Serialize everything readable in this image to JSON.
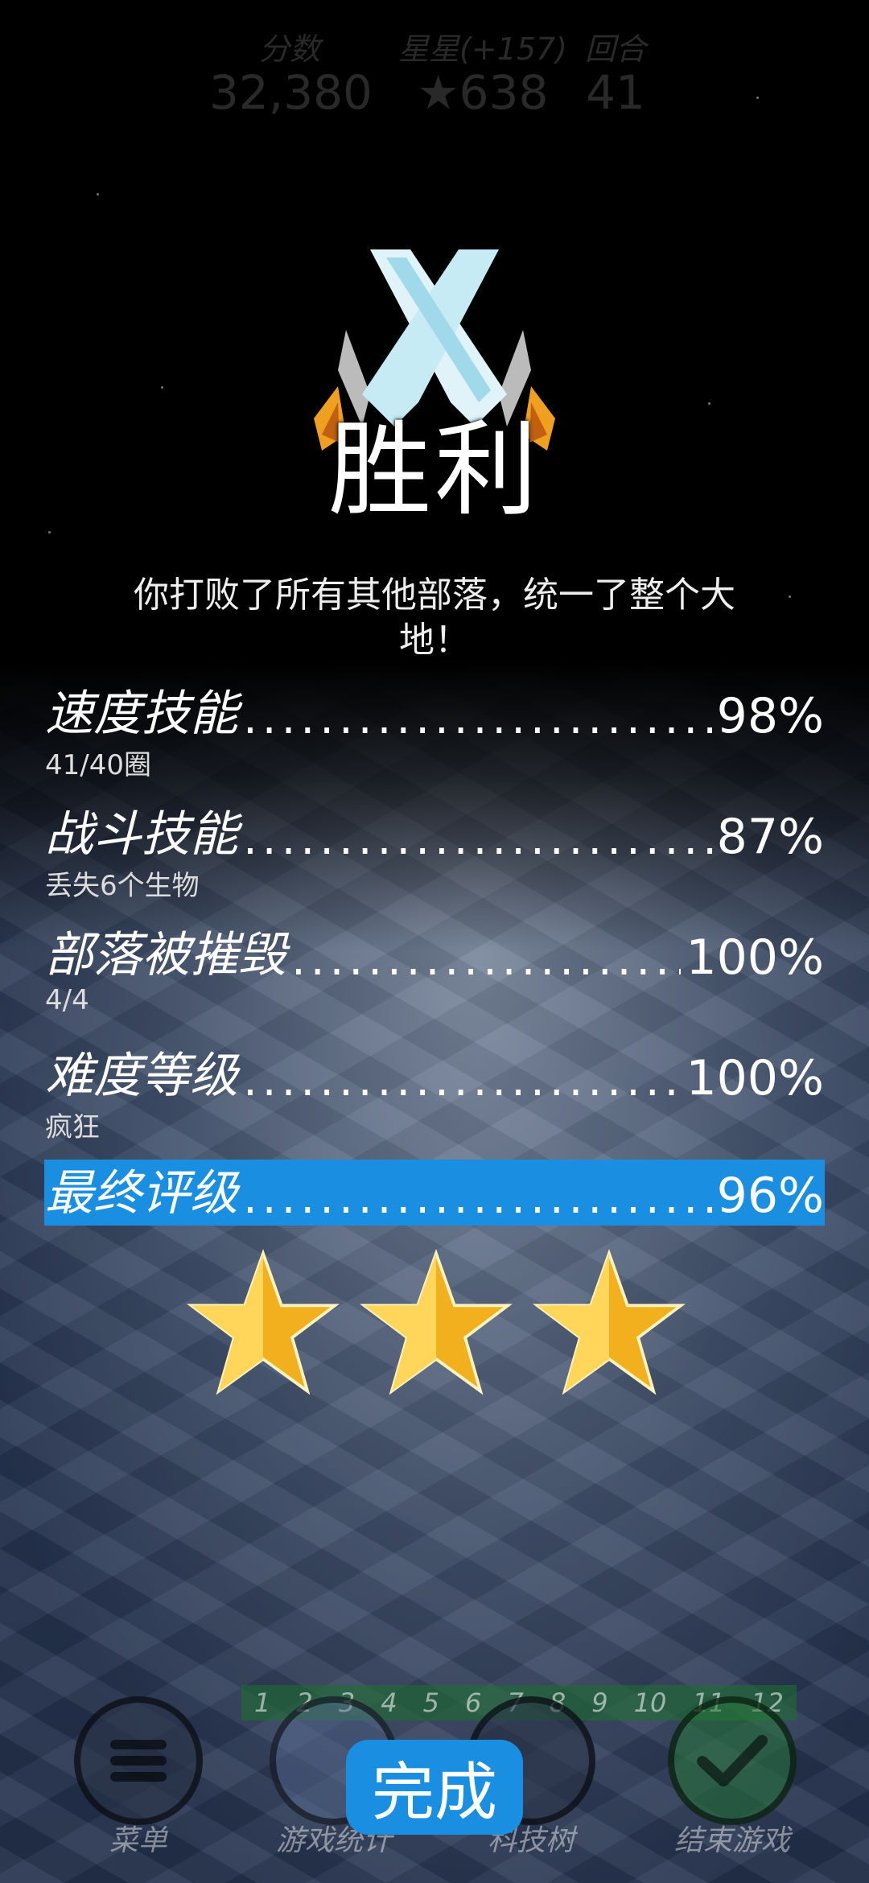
{
  "header": {
    "score_label": "分数",
    "score_value": "32,380",
    "stars_label": "星星(+157)",
    "stars_value": "638",
    "turn_label": "回合",
    "turn_value": "41"
  },
  "result": {
    "title": "胜利",
    "subtitle": "你打败了所有其他部落，统一了整个大地！"
  },
  "ratings": [
    {
      "label": "速度技能",
      "dots": "..........................",
      "percent": "98%",
      "detail": "41/40圈"
    },
    {
      "label": "战斗技能",
      "dots": "..........................",
      "percent": "87%",
      "detail": "丢失6个生物"
    },
    {
      "label": "部落被摧毁",
      "dots": "..........................",
      "percent": "100%",
      "detail": "4/4"
    },
    {
      "label": "难度等级",
      "dots": "..........................",
      "percent": "100%",
      "detail": "疯狂"
    }
  ],
  "final": {
    "label": "最终评级",
    "dots": "..........................",
    "percent": "96%"
  },
  "star_rating": 3,
  "turn_strip": [
    "1",
    "2",
    "3",
    "4",
    "5",
    "6",
    "7",
    "8",
    "9",
    "10",
    "11",
    "12"
  ],
  "nav": {
    "menu": "菜单",
    "stats": "游戏统计",
    "tech": "科技树",
    "end": "结束游戏"
  },
  "done_label": "完成",
  "colors": {
    "accent": "#1a8ee0",
    "star_gold": "#f2b01e"
  }
}
